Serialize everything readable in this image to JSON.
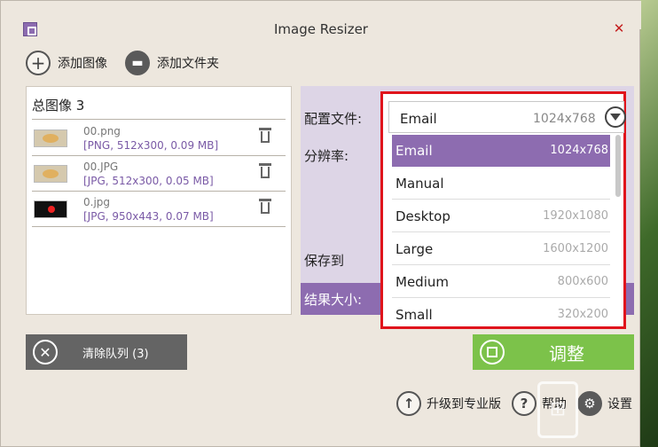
{
  "window": {
    "title": "Image Resizer"
  },
  "toolbar": {
    "add_images_label": "添加图像",
    "add_folder_label": "添加文件夹"
  },
  "list": {
    "total_label": "总图像 3",
    "files": [
      {
        "name": "00.png",
        "info": "[PNG, 512x300, 0.09 MB]"
      },
      {
        "name": "00.JPG",
        "info": "[JPG, 512x300, 0.05 MB]"
      },
      {
        "name": "0.jpg",
        "info": "[JPG, 950x443, 0.07 MB]"
      }
    ]
  },
  "settings": {
    "profile_label": "配置文件:",
    "resolution_label": "分辨率:",
    "save_to_label": "保存到",
    "result_size_label": "结果大小:"
  },
  "profile_dropdown": {
    "selected_name": "Email",
    "selected_size": "1024x768",
    "options": [
      {
        "name": "Email",
        "size": "1024x768"
      },
      {
        "name": "Manual",
        "size": ""
      },
      {
        "name": "Desktop",
        "size": "1920x1080"
      },
      {
        "name": "Large",
        "size": "1600x1200"
      },
      {
        "name": "Medium",
        "size": "800x600"
      },
      {
        "name": "Small",
        "size": "320x200"
      }
    ]
  },
  "buttons": {
    "clear_queue": "清除队列 (3)",
    "resize": "调整"
  },
  "footer": {
    "upgrade": "升级到专业版",
    "help": "帮助",
    "settings": "设置"
  },
  "colors": {
    "accent_purple": "#8d6cb0",
    "resize_green": "#7cc24a",
    "highlight_red": "#e0141c"
  }
}
